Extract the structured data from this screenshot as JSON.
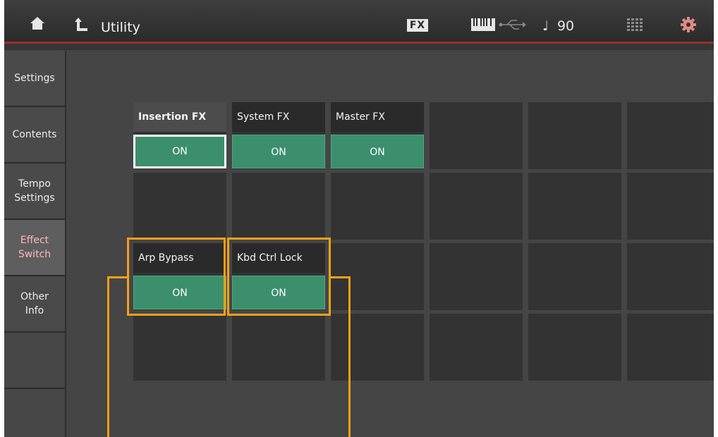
{
  "header": {
    "title": "Utility",
    "fx_badge": "FX",
    "tempo": "90",
    "tempo_symbol": "♩"
  },
  "sidebar": {
    "items": [
      {
        "label": "Settings"
      },
      {
        "label": "Contents"
      },
      {
        "label": "Tempo\nSettings"
      },
      {
        "label": "Effect\nSwitch",
        "active": true
      },
      {
        "label": "Other\nInfo"
      }
    ]
  },
  "switches": [
    {
      "label": "Insertion FX",
      "value": "ON"
    },
    {
      "label": "System FX",
      "value": "ON"
    },
    {
      "label": "Master FX",
      "value": "ON"
    },
    {
      "label": "Arp Bypass",
      "value": "ON"
    },
    {
      "label": "Kbd Ctrl Lock",
      "value": "ON"
    }
  ],
  "colors": {
    "accent_on": "#3c8f6c",
    "active_tab_text": "#ffb7bd",
    "highlight": "#f6a019"
  }
}
